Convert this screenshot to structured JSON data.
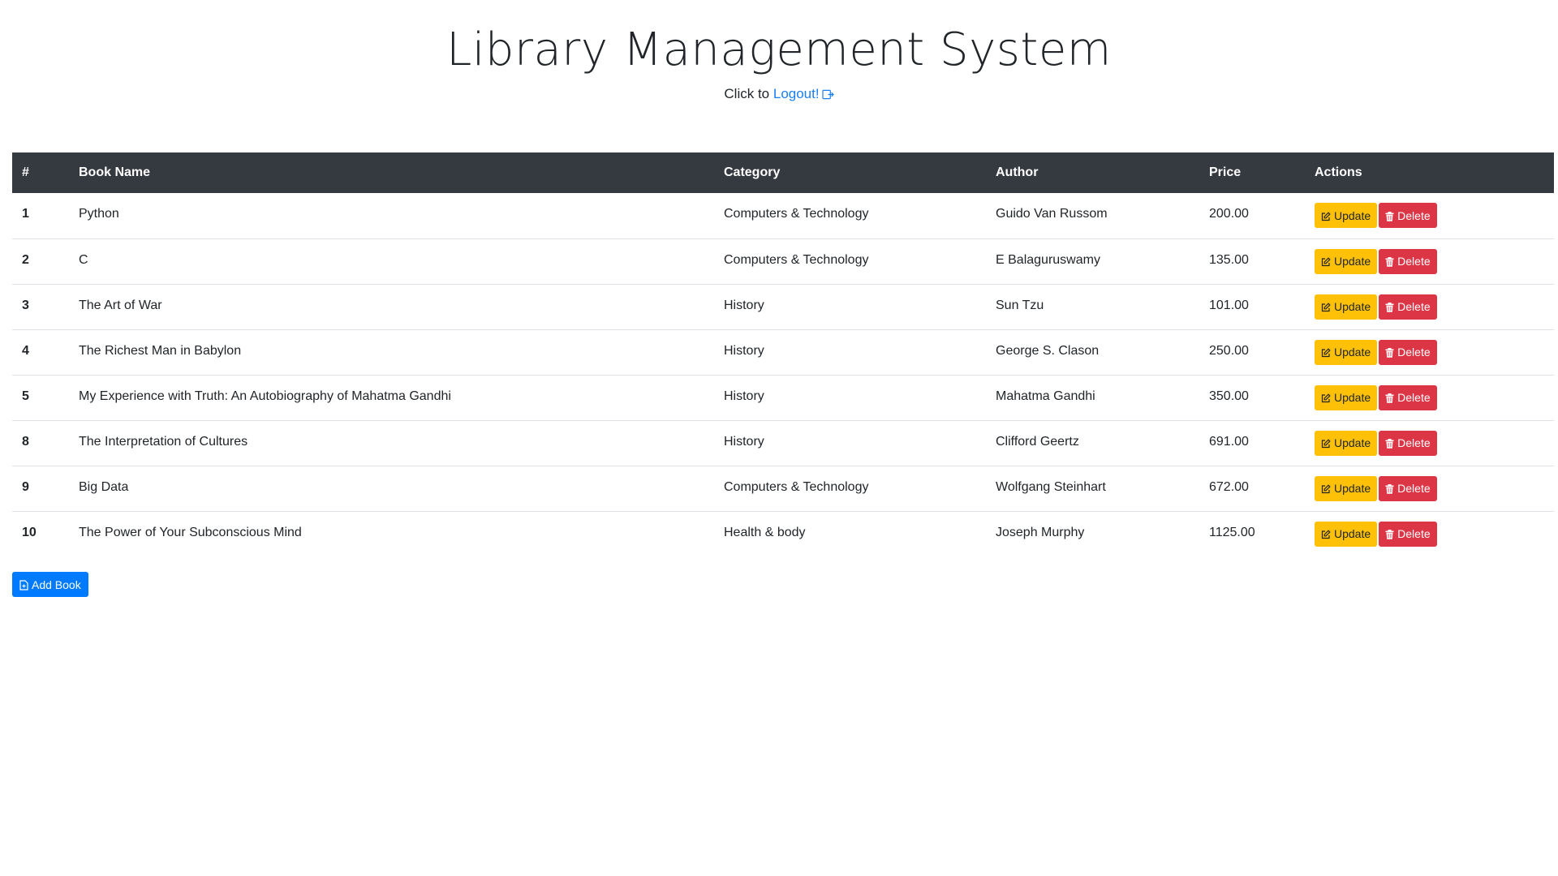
{
  "header": {
    "title": "Library Management System",
    "logout_prefix": "Click to",
    "logout_link": "Logout!",
    "logout_icon": "logout-icon"
  },
  "table": {
    "headers": [
      "#",
      "Book Name",
      "Category",
      "Author",
      "Price",
      "Actions"
    ],
    "rows": [
      {
        "id": "1",
        "name": "Python",
        "category": "Computers & Technology",
        "author": "Guido Van Russom",
        "price": "200.00"
      },
      {
        "id": "2",
        "name": "C",
        "category": "Computers & Technology",
        "author": "E Balaguruswamy",
        "price": "135.00"
      },
      {
        "id": "3",
        "name": "The Art of War",
        "category": "History",
        "author": "Sun Tzu",
        "price": "101.00"
      },
      {
        "id": "4",
        "name": "The Richest Man in Babylon",
        "category": "History",
        "author": "George S. Clason",
        "price": "250.00"
      },
      {
        "id": "5",
        "name": "My Experience with Truth: An Autobiography of Mahatma Gandhi",
        "category": "History",
        "author": "Mahatma Gandhi",
        "price": "350.00"
      },
      {
        "id": "8",
        "name": "The Interpretation of Cultures",
        "category": "History",
        "author": "Clifford Geertz",
        "price": "691.00"
      },
      {
        "id": "9",
        "name": "Big Data",
        "category": "Computers & Technology",
        "author": "Wolfgang Steinhart",
        "price": "672.00"
      },
      {
        "id": "10",
        "name": "The Power of Your Subconscious Mind",
        "category": "Health & body",
        "author": "Joseph Murphy",
        "price": "1125.00"
      }
    ],
    "update_label": "Update",
    "delete_label": "Delete",
    "update_icon": "edit-icon",
    "delete_icon": "trash-icon"
  },
  "add_book": {
    "label": "Add Book",
    "icon": "file-add-icon"
  },
  "colors": {
    "header_bg": "#343a40",
    "link": "#1a7ff5",
    "update": "#ffc107",
    "delete": "#dc3545",
    "primary": "#007bff"
  }
}
